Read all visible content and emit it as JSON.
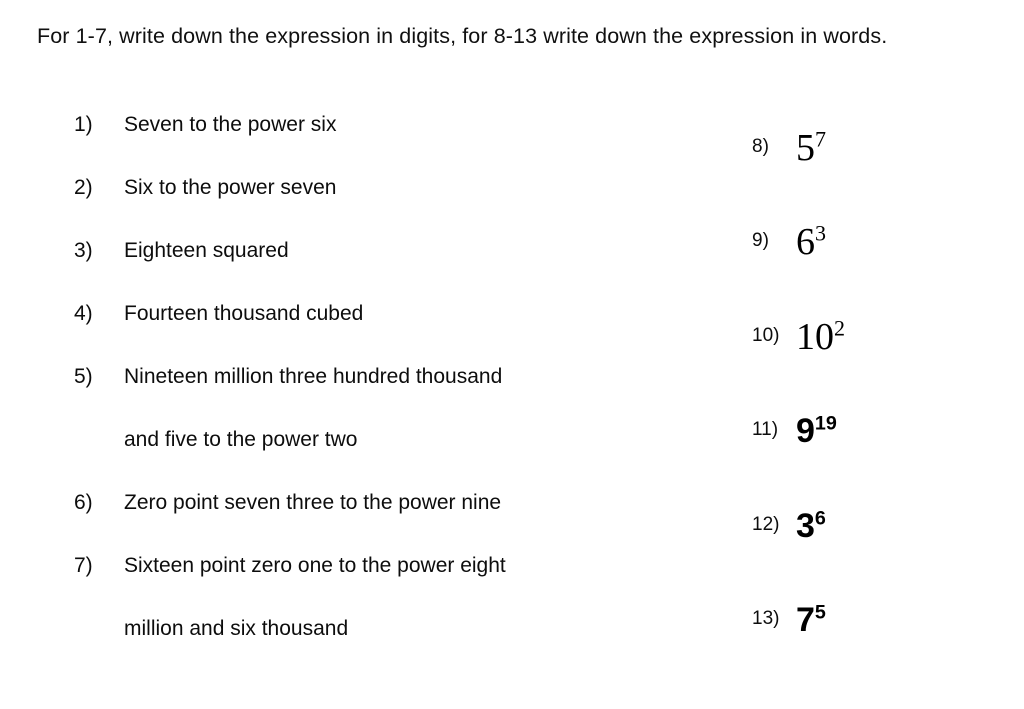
{
  "worksheet": {
    "instruction": "For 1-7, write down the expression in digits, for 8-13 write down the expression in words.",
    "words_questions": [
      {
        "number": "1)",
        "line1": "Seven to the power six",
        "line2": ""
      },
      {
        "number": "2)",
        "line1": "Six to the power seven",
        "line2": ""
      },
      {
        "number": "3)",
        "line1": "Eighteen squared",
        "line2": ""
      },
      {
        "number": "4)",
        "line1": "Fourteen thousand cubed",
        "line2": ""
      },
      {
        "number": "5)",
        "line1": "Nineteen million three hundred thousand",
        "line2": "and five to the power two"
      },
      {
        "number": "6)",
        "line1": "Zero point seven three to the power nine",
        "line2": ""
      },
      {
        "number": "7)",
        "line1": "Sixteen point zero one to the power eight",
        "line2": "million and six thousand"
      }
    ],
    "digit_questions": [
      {
        "number": "8)",
        "base": "5",
        "exponent": "7",
        "style": "serif"
      },
      {
        "number": "9)",
        "base": "6",
        "exponent": "3",
        "style": "serif"
      },
      {
        "number": "10)",
        "base": "10",
        "exponent": "2",
        "style": "serif"
      },
      {
        "number": "11)",
        "base": "9",
        "exponent": "19",
        "style": "sans"
      },
      {
        "number": "12)",
        "base": "3",
        "exponent": "6",
        "style": "sans"
      },
      {
        "number": "13)",
        "base": "7",
        "exponent": "5",
        "style": "sans"
      }
    ]
  },
  "colors": {
    "background": "#ffffff",
    "text": "#0d0d0d"
  }
}
